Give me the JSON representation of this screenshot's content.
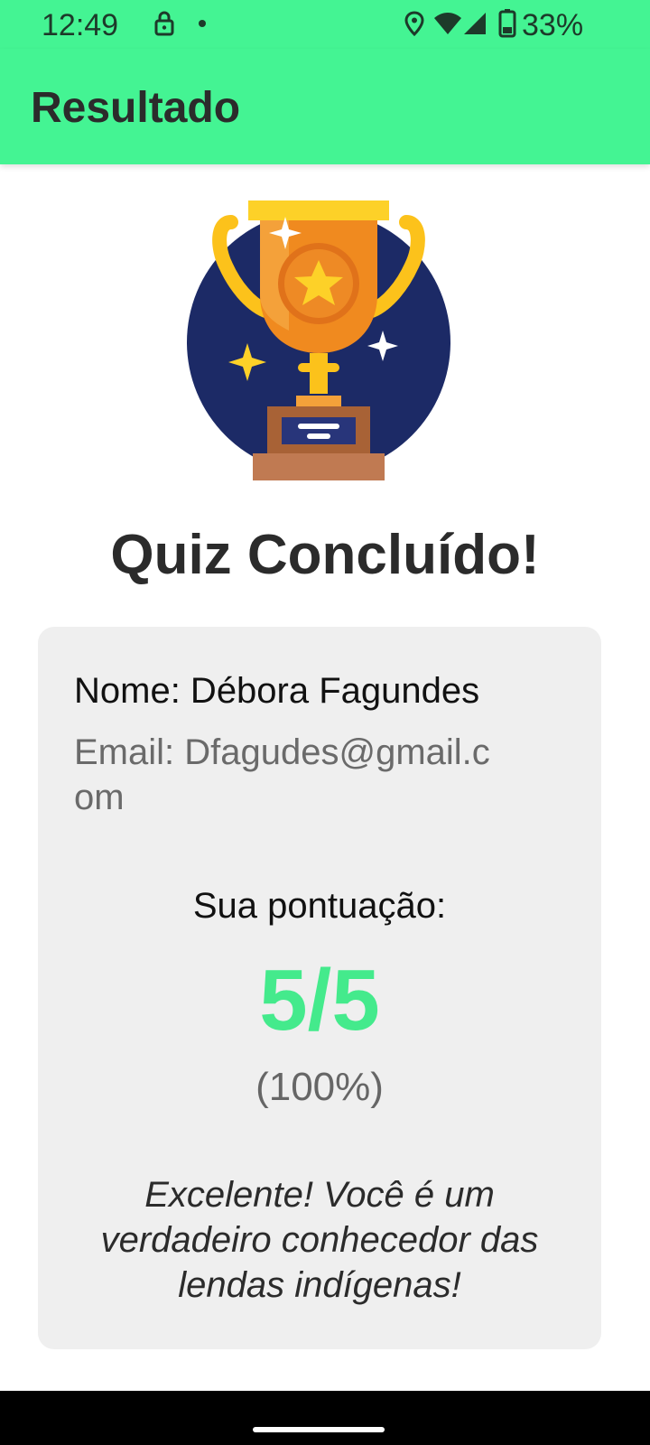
{
  "status_bar": {
    "time": "12:49",
    "battery": "33%",
    "icons": [
      "lock-icon",
      "notification-dot-icon",
      "location-icon",
      "wifi-icon",
      "signal-icon",
      "battery-icon"
    ]
  },
  "app_bar": {
    "title": "Resultado",
    "color": "#44f493"
  },
  "illustration": {
    "icon": "trophy-icon"
  },
  "main": {
    "title": "Quiz Concluído!"
  },
  "result": {
    "name": "Nome: Débora Fagundes",
    "email": "Email: Dfagudes@gmail.com",
    "score_label": "Sua pontuação:",
    "score": "5/5",
    "percent": "(100%)",
    "message": "Excelente! Você é um verdadeiro conhecedor das lendas indígenas!",
    "score_color": "#44ea8c"
  }
}
